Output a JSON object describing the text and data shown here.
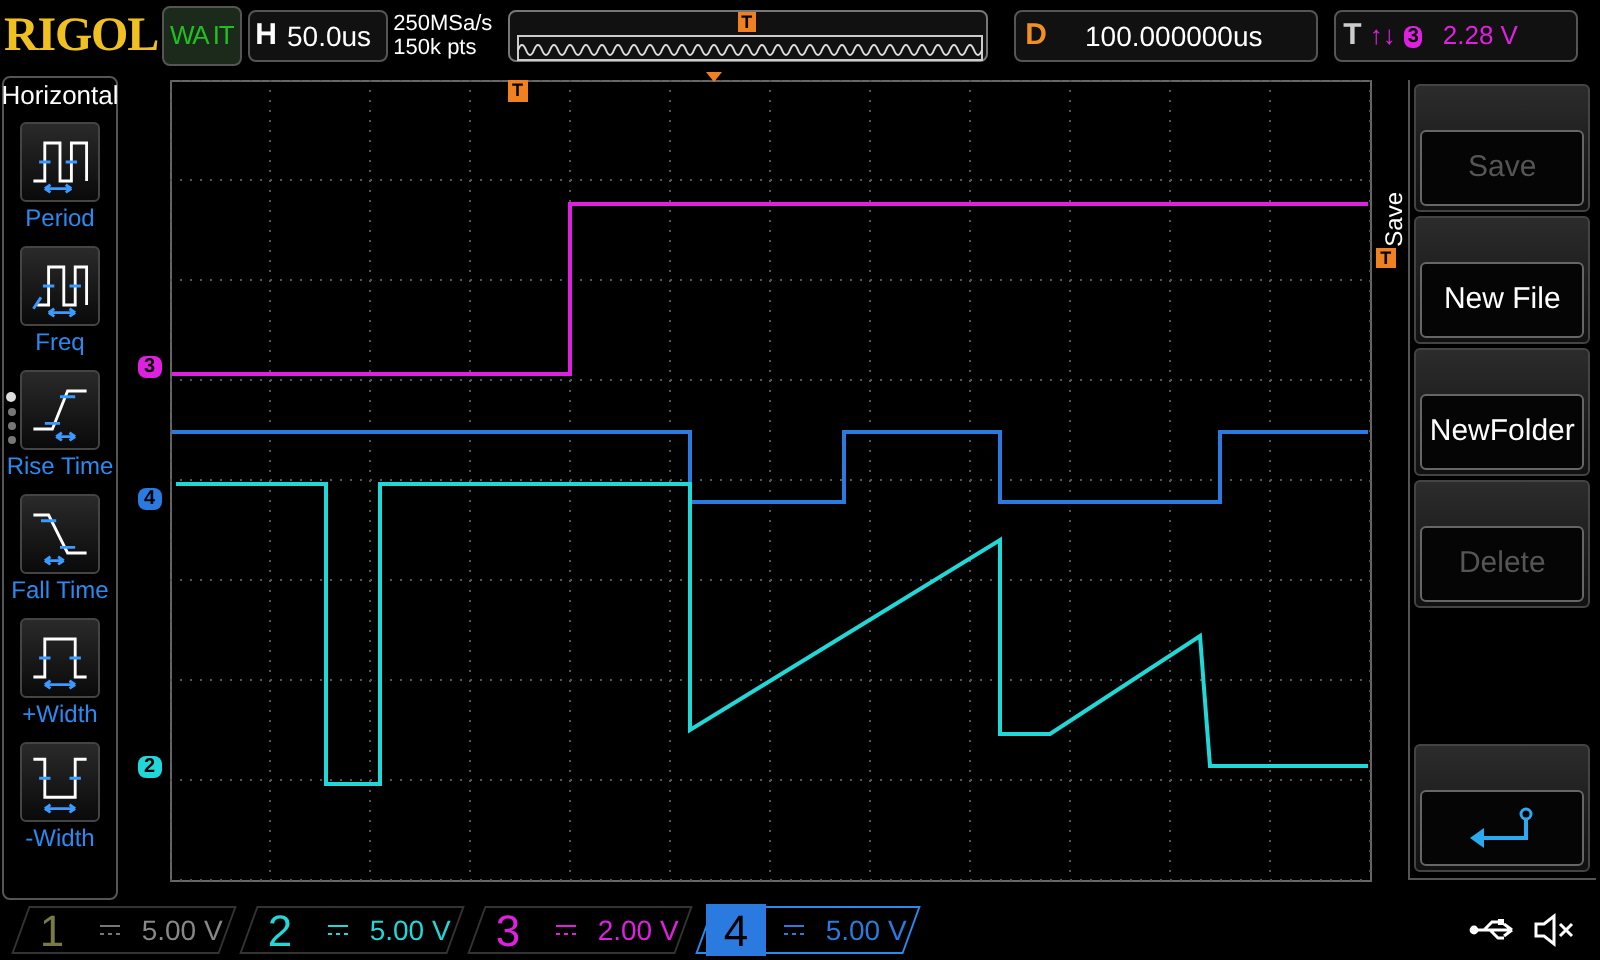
{
  "top_bar": {
    "logo": "RIGOL",
    "run_state": "WA IT",
    "horizontal": {
      "label": "H",
      "timebase": "50.0us"
    },
    "sample_rate": "250MSa/s",
    "memory_depth": "150k pts",
    "overview_marker": "T",
    "delay": {
      "label": "D",
      "value": "100.000000us"
    },
    "trigger": {
      "label": "T",
      "arrows": "↑↓",
      "channel": "3",
      "level": "2.28 V"
    }
  },
  "left_menu": {
    "title": "Horizontal",
    "items": [
      {
        "label": "Period",
        "kind": "period"
      },
      {
        "label": "Freq",
        "kind": "freq"
      },
      {
        "label": "Rise Time",
        "kind": "rise"
      },
      {
        "label": "Fall Time",
        "kind": "fall"
      },
      {
        "label": "+Width",
        "kind": "pwidth"
      },
      {
        "label": "-Width",
        "kind": "nwidth"
      }
    ],
    "pages": [
      {
        "selected": true
      },
      {
        "selected": false
      },
      {
        "selected": false
      },
      {
        "selected": false
      }
    ]
  },
  "screen": {
    "trigger_marker": "T",
    "level_marker": "T",
    "channel_markers": [
      {
        "label": "3",
        "color": "#e020e0",
        "kind": "ch3"
      },
      {
        "label": "4",
        "color": "#2a7ae0",
        "kind": "ch4"
      },
      {
        "label": "2",
        "color": "#20d8d8",
        "kind": "ch2"
      }
    ]
  },
  "right_menu": {
    "title": "Save",
    "buttons": [
      {
        "kind": "text",
        "label": "Save",
        "disabled": true
      },
      {
        "kind": "text",
        "label": "New File",
        "disabled": false
      },
      {
        "kind": "text",
        "label": "NewFolder",
        "disabled": false
      },
      {
        "kind": "text",
        "label": "Delete",
        "disabled": true
      },
      {
        "kind": "back"
      }
    ]
  },
  "channels": [
    {
      "number": "1",
      "scale": "5.00 V",
      "color": "#7a7a48",
      "on": false,
      "selected": false
    },
    {
      "number": "2",
      "scale": "5.00 V",
      "color": "#20d8d8",
      "on": true,
      "selected": false
    },
    {
      "number": "3",
      "scale": "2.00 V",
      "color": "#e020e0",
      "on": true,
      "selected": false
    },
    {
      "number": "4",
      "scale": "5.00 V",
      "color": "#2a7ae0",
      "on": true,
      "selected": true
    }
  ]
}
